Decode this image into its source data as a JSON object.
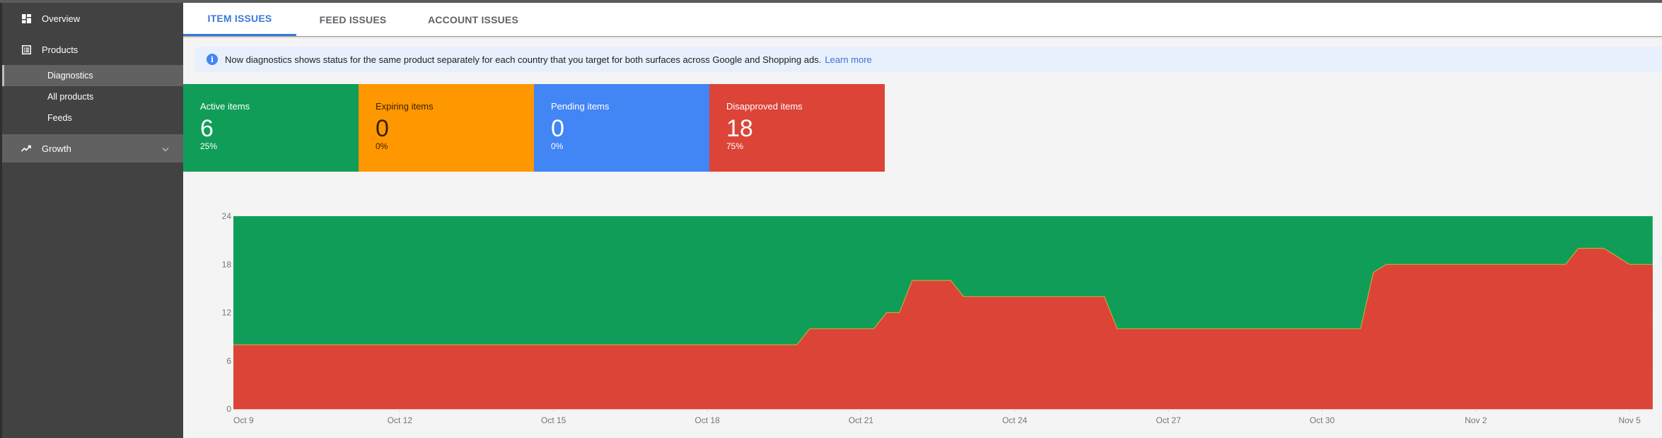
{
  "sidebar": {
    "items": [
      {
        "label": "Overview",
        "icon": "dashboard-icon"
      },
      {
        "label": "Products",
        "icon": "list-icon"
      }
    ],
    "subitems": [
      {
        "label": "Diagnostics",
        "active": true
      },
      {
        "label": "All products",
        "active": false
      },
      {
        "label": "Feeds",
        "active": false
      }
    ],
    "growth": {
      "label": "Growth",
      "icon": "trending-up-icon"
    }
  },
  "tabs": [
    {
      "label": "ITEM ISSUES",
      "active": true
    },
    {
      "label": "FEED ISSUES",
      "active": false
    },
    {
      "label": "ACCOUNT ISSUES",
      "active": false
    }
  ],
  "banner": {
    "icon": "info-icon",
    "text": "Now diagnostics shows status for the same product separately for each country that you target for both surfaces across Google and Shopping ads.",
    "link": "Learn more"
  },
  "cards": [
    {
      "label": "Active items",
      "value": "6",
      "percent": "25%",
      "color": "#109d58"
    },
    {
      "label": "Expiring items",
      "value": "0",
      "percent": "0%",
      "color": "#ff9800"
    },
    {
      "label": "Pending items",
      "value": "0",
      "percent": "0%",
      "color": "#4285f4"
    },
    {
      "label": "Disapproved items",
      "value": "18",
      "percent": "75%",
      "color": "#db4437"
    }
  ],
  "chart_data": {
    "type": "area",
    "title": "",
    "xlabel": "",
    "ylabel": "",
    "ylim": [
      0,
      24
    ],
    "yticks": [
      "0",
      "6",
      "12",
      "18",
      "24"
    ],
    "xticks": [
      "Oct 9",
      "Oct 12",
      "Oct 15",
      "Oct 18",
      "Oct 21",
      "Oct 24",
      "Oct 27",
      "Oct 30",
      "Nov 2",
      "Nov 5"
    ],
    "x_unit": "days since Oct 9",
    "x_range": [
      -0.25,
      27.45
    ],
    "series": [
      {
        "name": "Disapproved items",
        "color": "#db4437",
        "points": [
          [
            -0.25,
            8
          ],
          [
            10.75,
            8
          ],
          [
            11,
            10
          ],
          [
            12.25,
            10
          ],
          [
            12.5,
            12
          ],
          [
            12.75,
            12
          ],
          [
            13,
            16
          ],
          [
            13.75,
            16
          ],
          [
            14,
            14
          ],
          [
            16.75,
            14
          ],
          [
            17,
            10
          ],
          [
            21.75,
            10
          ],
          [
            22,
            17
          ],
          [
            22.25,
            18
          ],
          [
            25.75,
            18
          ],
          [
            26,
            20
          ],
          [
            26.5,
            20
          ],
          [
            27,
            18
          ],
          [
            27.45,
            18
          ]
        ]
      },
      {
        "name": "Active items",
        "color": "#109d58",
        "stacked_total": 24
      }
    ]
  }
}
